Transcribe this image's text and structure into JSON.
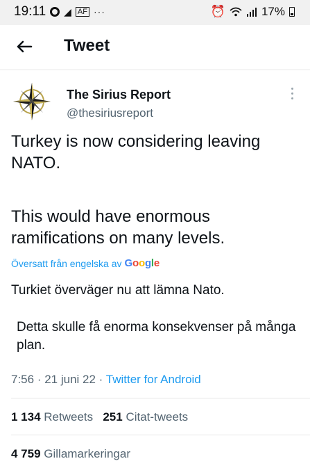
{
  "status_bar": {
    "time": "19:11",
    "battery": "17%",
    "icons": [
      "record-icon",
      "telegram-icon",
      "news-icon",
      "more-dots-icon",
      "alarm-icon",
      "wifi-icon",
      "signal-icon",
      "battery-icon"
    ]
  },
  "header": {
    "title": "Tweet"
  },
  "author": {
    "name": "The Sirius Report",
    "handle": "@thesiriusreport"
  },
  "tweet": {
    "text_line1": "Turkey is now considering leaving NATO.",
    "text_line2": "This would have enormous ramifications on many levels."
  },
  "translation": {
    "label": "Översatt från engelska av",
    "provider": "Google",
    "text_line1": "Turkiet överväger nu att lämna Nato.",
    "text_line2": "Detta skulle få enorma konsekvenser på många plan."
  },
  "meta": {
    "time": "7:56",
    "date": "21 juni 22",
    "source": "Twitter for Android"
  },
  "stats": {
    "retweets_count": "1 134",
    "retweets_label": "Retweets",
    "quotes_count": "251",
    "quotes_label": "Citat-tweets",
    "likes_count": "4 759",
    "likes_label": "Gillamarkeringar"
  }
}
